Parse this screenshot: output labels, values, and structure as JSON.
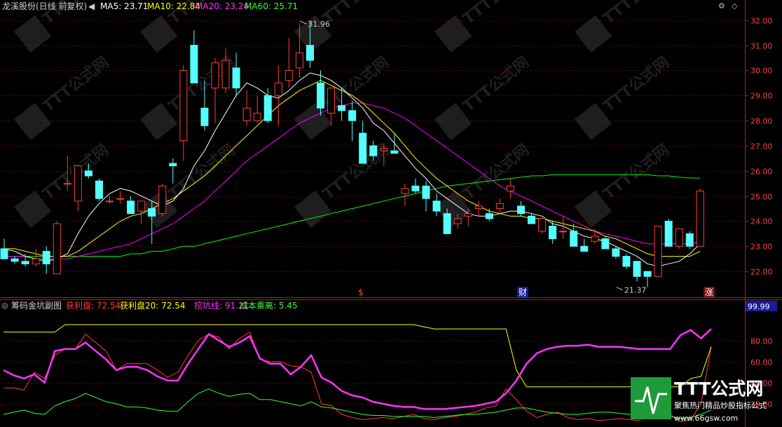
{
  "header": {
    "stock_title": "龙溪股份(日线 前复权)",
    "ma5": "MA5: 23.71",
    "ma10": "MA10: 22.84",
    "ma20": "MA20: 23.24",
    "ma60": "MA60: 25.71"
  },
  "sub_header": {
    "indicator_name": "筹码金坑副图",
    "profit_plate": "获利盘: 72.54",
    "profit_plate20": "获利盘20: 72.54",
    "dig_line": "挖坑线: 91.21",
    "cost_deviation": "成本乘离: 5.45",
    "current_value": "99.99"
  },
  "markers": {
    "dollar": "$",
    "finance": "财",
    "rise": "涨"
  },
  "watermark": {
    "brand": "TTT公式网",
    "site": "www.66gsw.com",
    "slogan": "聚焦热门精品炒股指标公式"
  },
  "colors": {
    "up": "#ff3b3b",
    "down": "#54ffff",
    "ma5": "#ffffff",
    "ma10": "#ffff00",
    "ma20": "#ff00ff",
    "ma60": "#00ff00"
  },
  "chart_data": [
    {
      "type": "candlestick",
      "ylim": [
        21.5,
        32.3
      ],
      "ytick_labels": [
        "22.00",
        "23.00",
        "24.00",
        "25.00",
        "26.00",
        "27.00",
        "28.00",
        "29.00",
        "30.00",
        "31.00",
        "32.00"
      ],
      "annotations": [
        {
          "text": "31.96",
          "value": 31.96,
          "bar": 28
        },
        {
          "text": "21.37",
          "value": 21.37,
          "bar": 58
        }
      ],
      "ohlc": [
        [
          22.9,
          23.3,
          22.5,
          22.5
        ],
        [
          22.5,
          22.6,
          22.3,
          22.4
        ],
        [
          22.4,
          22.7,
          22.2,
          22.3
        ],
        [
          22.3,
          22.9,
          22.2,
          22.5
        ],
        [
          22.8,
          23.0,
          21.9,
          22.3
        ],
        [
          21.9,
          24.0,
          21.9,
          23.9
        ],
        [
          25.5,
          26.6,
          25.2,
          25.5
        ],
        [
          24.8,
          26.2,
          24.4,
          26.2
        ],
        [
          26.0,
          26.3,
          25.7,
          25.8
        ],
        [
          25.6,
          25.7,
          24.8,
          24.9
        ],
        [
          24.8,
          25.0,
          24.7,
          24.8
        ],
        [
          24.9,
          25.2,
          24.7,
          24.9
        ],
        [
          24.8,
          25.0,
          24.4,
          24.3
        ],
        [
          24.4,
          24.7,
          23.9,
          24.8
        ],
        [
          24.5,
          24.8,
          23.1,
          24.2
        ],
        [
          24.3,
          25.5,
          24.2,
          25.4
        ],
        [
          26.3,
          26.5,
          25.5,
          26.2
        ],
        [
          27.2,
          30.2,
          26.4,
          30.0
        ],
        [
          31.0,
          31.6,
          29.5,
          29.5
        ],
        [
          28.5,
          29.6,
          27.6,
          27.8
        ],
        [
          29.3,
          30.5,
          27.9,
          30.3
        ],
        [
          29.3,
          30.9,
          29.1,
          30.4
        ],
        [
          30.1,
          30.7,
          29.0,
          29.3
        ],
        [
          28.0,
          29.2,
          27.8,
          28.5
        ],
        [
          28.0,
          29.0,
          27.9,
          28.3
        ],
        [
          29.0,
          29.3,
          27.9,
          28.0
        ],
        [
          29.0,
          30.2,
          27.8,
          29.5
        ],
        [
          29.6,
          31.3,
          29.3,
          30.0
        ],
        [
          30.1,
          31.9,
          29.7,
          30.7
        ],
        [
          31.0,
          31.96,
          30.1,
          30.4
        ],
        [
          29.5,
          30.0,
          28.2,
          28.5
        ],
        [
          28.3,
          29.0,
          27.8,
          29.3
        ],
        [
          28.6,
          29.3,
          28.0,
          28.4
        ],
        [
          28.4,
          28.8,
          27.2,
          28.0
        ],
        [
          27.5,
          28.0,
          26.3,
          26.3
        ],
        [
          27.0,
          27.2,
          26.4,
          26.6
        ],
        [
          26.8,
          27.1,
          26.2,
          26.9
        ],
        [
          26.8,
          27.5,
          26.7,
          26.7
        ],
        [
          25.1,
          25.5,
          24.6,
          25.3
        ],
        [
          25.4,
          25.7,
          25.1,
          25.2
        ],
        [
          25.4,
          25.6,
          24.4,
          24.9
        ],
        [
          24.8,
          25.1,
          24.2,
          24.4
        ],
        [
          24.3,
          24.5,
          23.5,
          23.5
        ],
        [
          23.9,
          24.3,
          23.7,
          24.1
        ],
        [
          24.2,
          24.5,
          23.8,
          24.3
        ],
        [
          24.5,
          24.8,
          24.2,
          24.6
        ],
        [
          24.3,
          24.5,
          24.0,
          24.1
        ],
        [
          24.5,
          24.9,
          24.3,
          24.7
        ],
        [
          25.2,
          25.7,
          24.9,
          25.4
        ],
        [
          24.6,
          24.8,
          24.2,
          24.3
        ],
        [
          24.2,
          24.3,
          23.9,
          23.9
        ],
        [
          23.6,
          24.1,
          23.5,
          24.1
        ],
        [
          23.8,
          24.0,
          23.1,
          23.3
        ],
        [
          23.6,
          24.2,
          23.3,
          23.6
        ],
        [
          23.6,
          23.9,
          23.0,
          23.0
        ],
        [
          23.0,
          23.3,
          22.8,
          22.8
        ],
        [
          23.2,
          23.7,
          23.1,
          23.4
        ],
        [
          23.3,
          23.4,
          22.9,
          22.9
        ],
        [
          22.9,
          23.0,
          22.5,
          22.6
        ],
        [
          22.6,
          22.7,
          22.1,
          22.2
        ],
        [
          22.4,
          22.4,
          21.6,
          21.8
        ],
        [
          22.0,
          22.0,
          21.37,
          21.8
        ],
        [
          21.8,
          23.8,
          21.8,
          23.8
        ],
        [
          24.0,
          24.1,
          23.0,
          23.0
        ],
        [
          23.0,
          23.7,
          22.9,
          23.7
        ],
        [
          23.5,
          23.6,
          22.9,
          23.0
        ],
        [
          23.0,
          25.3,
          23.0,
          25.2
        ]
      ],
      "ma5": [
        22.9,
        22.8,
        22.6,
        22.5,
        22.4,
        22.5,
        22.7,
        23.5,
        24.2,
        24.7,
        25.1,
        25.3,
        25.2,
        25.0,
        24.8,
        24.6,
        24.8,
        25.3,
        26.2,
        26.8,
        27.6,
        28.3,
        29.0,
        29.5,
        29.3,
        29.0,
        28.9,
        29.2,
        29.6,
        29.9,
        29.8,
        29.6,
        29.3,
        28.9,
        28.5,
        27.9,
        27.6,
        27.1,
        26.6,
        26.1,
        25.7,
        25.2,
        24.9,
        24.6,
        24.3,
        24.2,
        24.2,
        24.3,
        24.4,
        24.4,
        24.3,
        24.2,
        23.9,
        23.8,
        23.6,
        23.4,
        23.3,
        23.2,
        23.0,
        22.8,
        22.6,
        22.3,
        22.2,
        22.3,
        22.4,
        22.7,
        23.1
      ],
      "ma10": [
        22.9,
        22.9,
        22.8,
        22.7,
        22.6,
        22.6,
        22.6,
        22.8,
        23.1,
        23.4,
        23.7,
        24.0,
        24.2,
        24.3,
        24.5,
        24.7,
        24.9,
        25.2,
        25.5,
        25.8,
        26.2,
        26.6,
        27.0,
        27.4,
        27.8,
        28.2,
        28.6,
        28.9,
        29.2,
        29.4,
        29.6,
        29.4,
        29.2,
        29.0,
        28.7,
        28.3,
        27.9,
        27.5,
        27.0,
        26.5,
        26.1,
        25.7,
        25.4,
        25.1,
        24.8,
        24.6,
        24.4,
        24.3,
        24.2,
        24.2,
        24.1,
        24.1,
        24.0,
        23.9,
        23.8,
        23.7,
        23.6,
        23.4,
        23.3,
        23.1,
        22.9,
        22.7,
        22.6,
        22.6,
        22.6,
        22.6,
        22.8
      ],
      "ma20": [
        22.6,
        22.6,
        22.6,
        22.5,
        22.5,
        22.5,
        22.5,
        22.6,
        22.7,
        22.8,
        22.9,
        23.0,
        23.1,
        23.3,
        23.5,
        23.7,
        23.9,
        24.2,
        24.5,
        24.8,
        25.2,
        25.6,
        26.0,
        26.4,
        26.7,
        27.0,
        27.3,
        27.6,
        27.9,
        28.1,
        28.3,
        28.5,
        28.6,
        28.7,
        28.7,
        28.6,
        28.5,
        28.3,
        28.1,
        27.8,
        27.5,
        27.2,
        26.9,
        26.6,
        26.3,
        26.0,
        25.7,
        25.4,
        25.2,
        25.0,
        24.8,
        24.6,
        24.4,
        24.2,
        24.0,
        23.8,
        23.6,
        23.5,
        23.4,
        23.3,
        23.2,
        23.1,
        23.1,
        23.1,
        23.1,
        23.1,
        23.2
      ],
      "ma60": [
        22.6,
        22.6,
        22.6,
        22.6,
        22.6,
        22.6,
        22.6,
        22.6,
        22.6,
        22.6,
        22.6,
        22.6,
        22.7,
        22.7,
        22.8,
        22.8,
        22.9,
        23.0,
        23.0,
        23.1,
        23.2,
        23.3,
        23.4,
        23.5,
        23.6,
        23.7,
        23.8,
        23.9,
        24.0,
        24.1,
        24.2,
        24.3,
        24.4,
        24.5,
        24.6,
        24.7,
        24.8,
        24.9,
        25.0,
        25.1,
        25.2,
        25.3,
        25.4,
        25.45,
        25.5,
        25.55,
        25.6,
        25.65,
        25.7,
        25.75,
        25.8,
        25.8,
        25.85,
        25.85,
        25.85,
        25.85,
        25.85,
        25.85,
        25.85,
        25.85,
        25.85,
        25.85,
        25.8,
        25.8,
        25.75,
        25.72,
        25.71
      ]
    },
    {
      "type": "line",
      "ylim": [
        0,
        105
      ],
      "ytick_labels": [
        "80.00",
        "60.00",
        "40.00",
        "20.00"
      ],
      "series": [
        {
          "name": "获利盘",
          "color": "#ff3b3b",
          "values": [
            35,
            35,
            33,
            50,
            44,
            66,
            72,
            72,
            86,
            78,
            70,
            52,
            58,
            58,
            58,
            52,
            45,
            50,
            66,
            80,
            86,
            83,
            72,
            82,
            88,
            62,
            60,
            60,
            56,
            55,
            50,
            20,
            18,
            10,
            7,
            5,
            6,
            7,
            6,
            8,
            10,
            6,
            5,
            7,
            8,
            10,
            12,
            16,
            18,
            34,
            24,
            13,
            7,
            10,
            12,
            7,
            5,
            6,
            4,
            5,
            6,
            5,
            4,
            18,
            14,
            10,
            3,
            5,
            20,
            74
          ]
        },
        {
          "name": "获利盘20",
          "color": "#ffff00",
          "values": [
            88,
            88,
            88,
            88,
            88,
            88,
            95,
            95,
            95,
            95,
            95,
            95,
            95,
            95,
            95,
            95,
            95,
            95,
            95,
            95,
            95,
            95,
            95,
            95,
            95,
            95,
            95,
            95,
            95,
            95,
            95,
            95,
            95,
            95,
            95,
            95,
            95,
            95,
            95,
            95,
            95,
            93,
            91,
            91,
            91,
            91,
            91,
            91,
            91,
            91,
            52,
            36,
            36,
            36,
            36,
            36,
            36,
            36,
            36,
            36,
            36,
            36,
            36,
            36,
            36,
            36,
            36,
            44,
            46,
            74
          ]
        },
        {
          "name": "挖坑线",
          "color": "#ff33ff",
          "values": [
            52,
            47,
            44,
            48,
            40,
            70,
            72,
            72,
            78,
            70,
            62,
            52,
            55,
            55,
            52,
            46,
            42,
            42,
            58,
            72,
            86,
            80,
            74,
            78,
            84,
            63,
            58,
            58,
            48,
            55,
            66,
            45,
            40,
            32,
            28,
            26,
            22,
            20,
            18,
            17,
            17,
            15,
            15,
            15,
            16,
            17,
            18,
            20,
            22,
            30,
            42,
            58,
            68,
            72,
            74,
            75,
            75,
            76,
            74,
            74,
            74,
            73,
            72,
            72,
            72,
            72,
            85,
            90,
            82,
            91
          ]
        },
        {
          "name": "成本乘离",
          "color": "#33ff33",
          "values": [
            10,
            12,
            14,
            11,
            10,
            18,
            22,
            25,
            30,
            26,
            22,
            20,
            17,
            17,
            16,
            14,
            13,
            13,
            22,
            30,
            34,
            30,
            27,
            29,
            30,
            24,
            24,
            22,
            20,
            18,
            22,
            17,
            16,
            14,
            12,
            10,
            9,
            9,
            8,
            8,
            8,
            8,
            7,
            8,
            9,
            10,
            10,
            11,
            12,
            14,
            16,
            16,
            14,
            12,
            11,
            10,
            10,
            11,
            12,
            12,
            11,
            10,
            9,
            8,
            8,
            8,
            6,
            7,
            10,
            14
          ]
        }
      ]
    }
  ]
}
